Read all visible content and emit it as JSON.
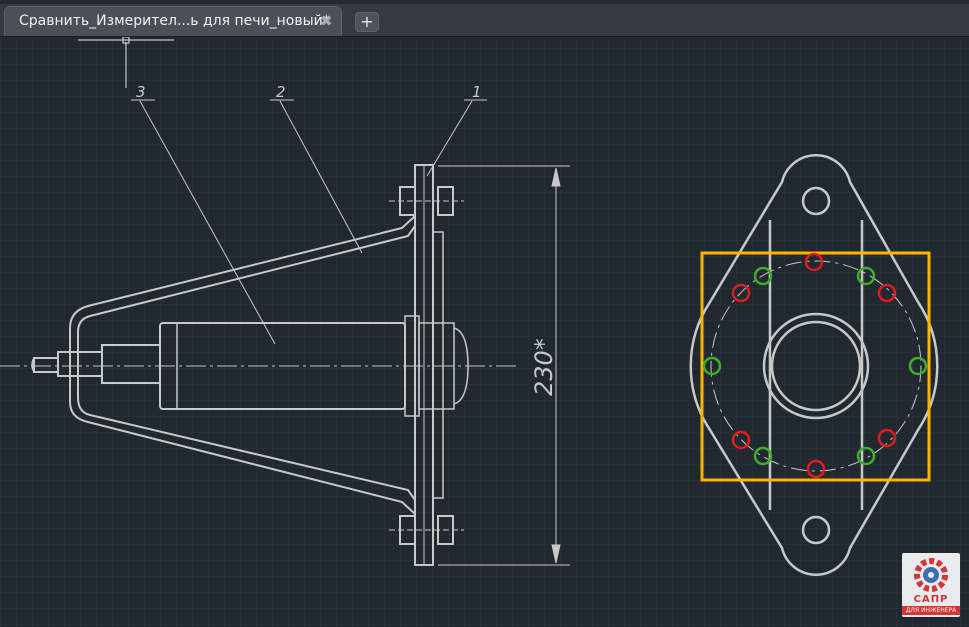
{
  "tab": {
    "title": "Сравнить_Измерител...ь для печи_новый*",
    "close_glyph": "✖"
  },
  "new_tab_glyph": "+",
  "drawing": {
    "leaders": [
      "1",
      "2",
      "3"
    ],
    "dimension": "230*"
  },
  "logo": {
    "line1": "САПР",
    "line2": "ДЛЯ ИНЖЕНЕРА"
  },
  "colors": {
    "background": "#212830",
    "line": "#c8c8c8",
    "selection": "#ffb400",
    "hole_red": "#e01c1c",
    "hole_green": "#3cb028"
  },
  "icons": [
    "close-icon",
    "plus-icon",
    "gear-logo-icon"
  ]
}
